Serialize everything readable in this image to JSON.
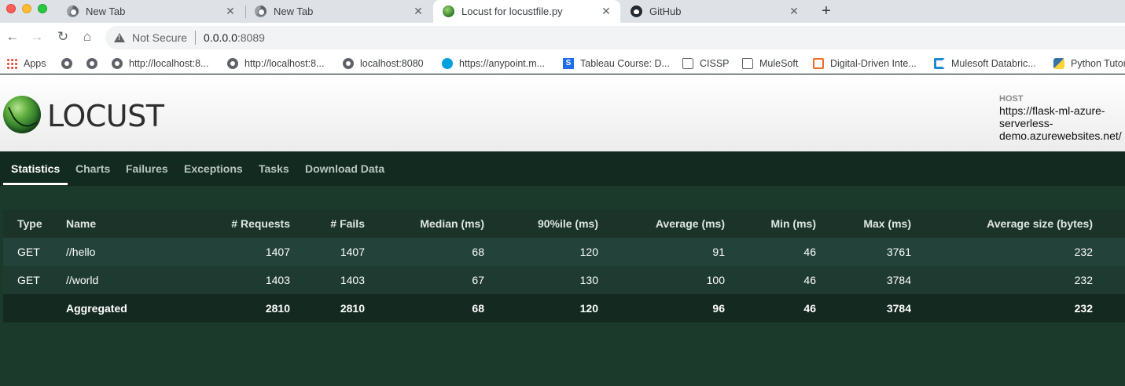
{
  "browser": {
    "tabs": [
      {
        "title": "New Tab",
        "icon": "chrome-icon",
        "active": false
      },
      {
        "title": "New Tab",
        "icon": "chrome-icon",
        "active": false
      },
      {
        "title": "Locust for locustfile.py",
        "icon": "locust-icon",
        "active": true
      },
      {
        "title": "GitHub",
        "icon": "github-icon",
        "active": false
      }
    ],
    "new_tab_label": "+",
    "close_glyph": "✕",
    "address": {
      "security_label": "Not Secure",
      "host": "0.0.0.0",
      "port": ":8089"
    },
    "bookmarks": [
      {
        "label": "Apps",
        "icon": "apps-grid-icon"
      },
      {
        "label": "",
        "icon": "globe-icon"
      },
      {
        "label": "",
        "icon": "globe-icon"
      },
      {
        "label": "http://localhost:8...",
        "icon": "globe-icon"
      },
      {
        "label": "http://localhost:8...",
        "icon": "globe-icon"
      },
      {
        "label": "localhost:8080",
        "icon": "globe-icon"
      },
      {
        "label": "https://anypoint.m...",
        "icon": "mulesoft-icon"
      },
      {
        "label": "Tableau Course: D...",
        "icon": "s-icon"
      },
      {
        "label": "CISSP",
        "icon": "folder-icon"
      },
      {
        "label": "MuleSoft",
        "icon": "folder-icon"
      },
      {
        "label": "Digital-Driven Inte...",
        "icon": "digital-driven-icon"
      },
      {
        "label": "Mulesoft Databric...",
        "icon": "mulesoft-databricks-icon"
      },
      {
        "label": "Python Tutori",
        "icon": "python-icon"
      }
    ]
  },
  "locust": {
    "logo_text": "LOCUST",
    "host_label": "HOST",
    "host_value": "https://flask-ml-azure-serverless-demo.azurewebsites.net/",
    "nav": [
      "Statistics",
      "Charts",
      "Failures",
      "Exceptions",
      "Tasks",
      "Download Data"
    ],
    "active_nav": "Statistics",
    "stats": {
      "columns": [
        "Type",
        "Name",
        "# Requests",
        "# Fails",
        "Median (ms)",
        "90%ile (ms)",
        "Average (ms)",
        "Min (ms)",
        "Max (ms)",
        "Average size (bytes)"
      ],
      "rows": [
        [
          "GET",
          "//hello",
          "1407",
          "1407",
          "68",
          "120",
          "91",
          "46",
          "3761",
          "232"
        ],
        [
          "GET",
          "//world",
          "1403",
          "1403",
          "67",
          "130",
          "100",
          "46",
          "3784",
          "232"
        ]
      ],
      "aggregated": [
        "",
        "Aggregated",
        "2810",
        "2810",
        "68",
        "120",
        "96",
        "46",
        "3784",
        "232"
      ]
    }
  },
  "colors": {
    "page_bg": "#1c3a2c",
    "nav_bg": "#122a20",
    "header_row_bg": "#1b3328",
    "row_a_bg": "#22423a",
    "row_b_bg": "#1e3a31",
    "aggregated_bg": "#142a21"
  }
}
